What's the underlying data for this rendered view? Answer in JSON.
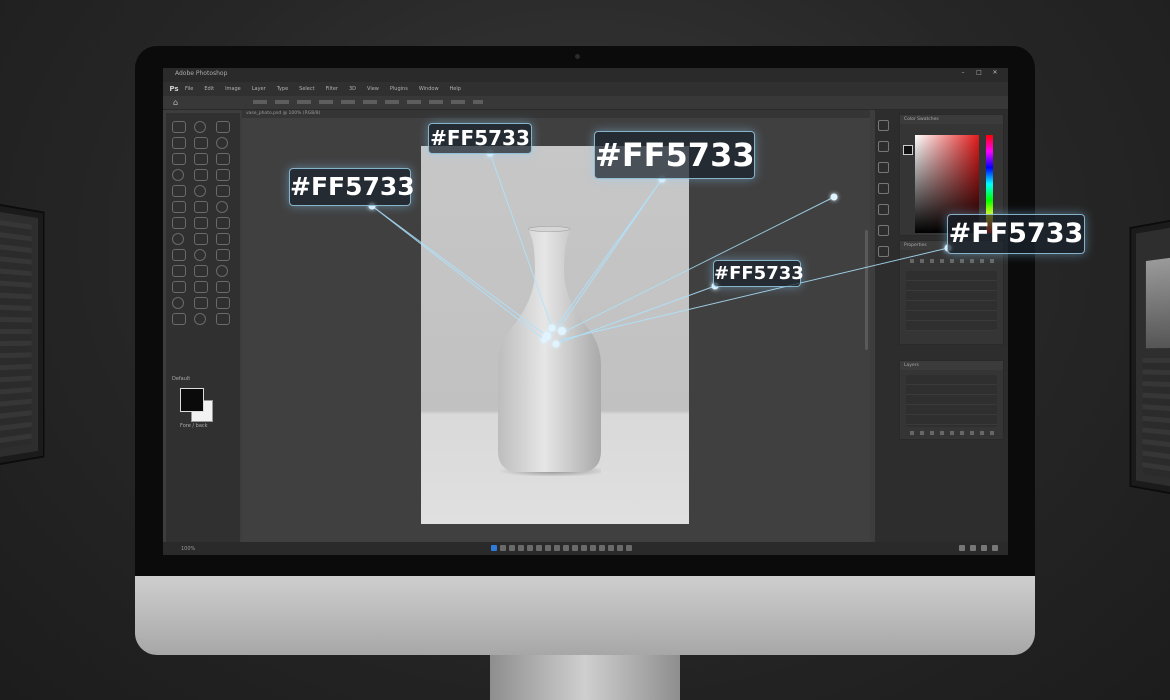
{
  "app": {
    "title": "Adobe Photoshop",
    "logo": "Ps",
    "menus": [
      "File",
      "Edit",
      "Image",
      "Layer",
      "Type",
      "Select",
      "Filter",
      "3D",
      "View",
      "Plugins",
      "Window",
      "Help"
    ],
    "document_tab": "vase_photo.psd @ 100% (RGB/8)",
    "status_text": "100%"
  },
  "tools": {
    "count": 39,
    "label": "Default",
    "swatch_label": "Fore / back",
    "foreground": "#0a0a0a",
    "background": "#f2f2f2"
  },
  "panels": {
    "color_tab": "Color  Swatches",
    "properties_tab": "Properties",
    "layers_tab": "Layers"
  },
  "color_tags": [
    {
      "id": "tag-1",
      "text": "#FF5733"
    },
    {
      "id": "tag-2",
      "text": "#FF5733"
    },
    {
      "id": "tag-3",
      "text": "#FF5733"
    },
    {
      "id": "tag-4",
      "text": "#FF5733"
    },
    {
      "id": "tag-5",
      "text": "#FF5733"
    }
  ],
  "colors": {
    "accent_glow": "#aee4ff",
    "sampled_color": "#FF5733",
    "ui_dark": "#2d2d2d"
  },
  "icons": [
    "home-icon",
    "minimize-icon",
    "maximize-icon",
    "close-icon",
    "eyedropper-icon",
    "hue-slider-icon"
  ]
}
